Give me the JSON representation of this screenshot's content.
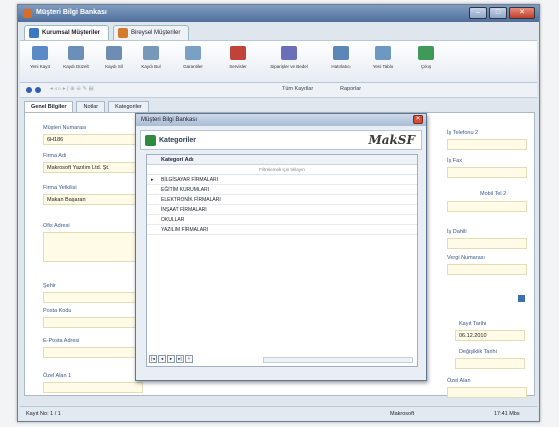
{
  "window": {
    "title": "Müşteri Bilgi Bankası"
  },
  "tabs": [
    {
      "label": "Kurumsal Müşteriler",
      "active": true
    },
    {
      "label": "Bireysel Müşteriler",
      "active": false
    }
  ],
  "toolbar": [
    {
      "label": "Yeni Kayıt",
      "icon": "new-record-icon",
      "color": "#5b8ac7"
    },
    {
      "label": "Kaydı Düzelt",
      "icon": "edit-record-icon",
      "color": "#6a8fb9"
    },
    {
      "label": "Kaydı Sil",
      "icon": "delete-record-icon",
      "color": "#6d8db3"
    },
    {
      "label": "Kaydı Bul",
      "icon": "find-record-icon",
      "color": "#7797bb"
    },
    {
      "label": "Garantiler",
      "icon": "warranty-icon",
      "color": "#7aa0c6"
    },
    {
      "label": "Servisler",
      "icon": "service-icon",
      "color": "#c0433a"
    },
    {
      "label": "Siparişler ve Bedel",
      "icon": "orders-icon",
      "color": "#6b6fb9"
    },
    {
      "label": "Hatırlatıcı",
      "icon": "reminder-icon",
      "color": "#5c86b7"
    },
    {
      "label": "Yeni Tablo",
      "icon": "table-icon",
      "color": "#6e98c2"
    },
    {
      "label": "Çıkış",
      "icon": "exit-icon",
      "color": "#3f9a5a"
    }
  ],
  "navbar": {
    "filter": "Tüm Kayıtlar",
    "reports": "Raporlar"
  },
  "subtabs": [
    "Genel Bilgiler",
    "Notlar",
    "Kategoriler"
  ],
  "form": {
    "left": [
      {
        "label": "Müşteri Numarası",
        "value": "6H186"
      },
      {
        "label": "Firma Adı",
        "value": "Makrosoft Yazılım Ltd. Şt."
      },
      {
        "label": "Firma Yetkilisi",
        "value": "Makan Başaran"
      },
      {
        "label": "Ofis Adresi",
        "value": ""
      },
      {
        "label": "Şehir",
        "value": ""
      },
      {
        "label": "Posta Kodu",
        "value": ""
      },
      {
        "label": "E-Posta Adresi",
        "value": ""
      },
      {
        "label": "Özel Alan 1",
        "value": ""
      }
    ],
    "right": [
      {
        "label": "İş Telefonu 2",
        "value": ""
      },
      {
        "label": "İş Fax",
        "value": ""
      },
      {
        "label": "Mobil Tel 2",
        "value": ""
      },
      {
        "label": "İş Dahili",
        "value": ""
      },
      {
        "label": "Vergi Numarası",
        "value": ""
      },
      {
        "label": "Kayıt Tarihi",
        "value": "06.12.2010"
      },
      {
        "label": "Değişiklik Tarihi",
        "value": ""
      },
      {
        "label": "Özel Alan",
        "value": ""
      }
    ]
  },
  "dialog": {
    "title": "Müşteri Bilgi Bankası",
    "header": "Kategoriler",
    "logo": "Makrosoft",
    "grid": {
      "column": "Kategori Adı",
      "filter_hint": "Filtrelemek için tıklayın",
      "rows": [
        "BİLGİSAYAR FİRMALARI",
        "EĞİTİM KURUMLARI",
        "ELEKTRONİK FİRMALARI",
        "İNŞAAT FİRMALARI",
        "OKULLAR",
        "YAZILIM FİRMALARI"
      ]
    }
  },
  "statusbar": {
    "record": "Kayıt No: 1 / 1",
    "brand": "Makrosoft",
    "time": "17:41 Mbs"
  }
}
